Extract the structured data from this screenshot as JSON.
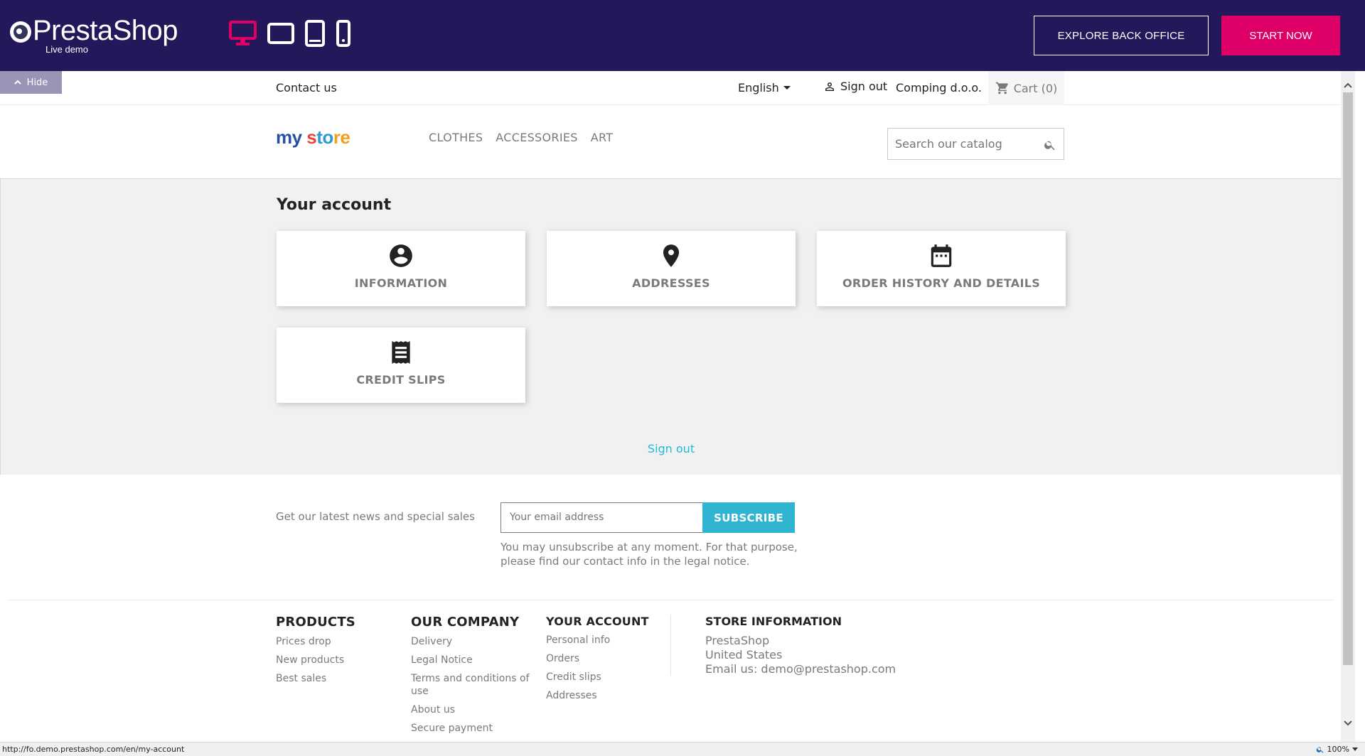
{
  "demo_bar": {
    "brand": "PrestaShop",
    "brand_sub": "Live demo",
    "explore_label": "EXPLORE BACK OFFICE",
    "start_label": "START NOW",
    "hide_label": "Hide",
    "active_device_color": "#df0067",
    "bar_color": "#25185a"
  },
  "nav": {
    "contact": "Contact us",
    "language": "English",
    "signout": "Sign out",
    "customer": "Comping d.o.o.",
    "cart": "Cart (0)"
  },
  "header": {
    "logo": {
      "p1": "my",
      "p2": " s",
      "p3": "to",
      "p4": "re"
    },
    "menu": [
      "CLOTHES",
      "ACCESSORIES",
      "ART"
    ],
    "search_placeholder": "Search our catalog"
  },
  "account": {
    "title": "Your account",
    "tiles": [
      {
        "label": "INFORMATION",
        "icon": "account-circle-icon"
      },
      {
        "label": "ADDRESSES",
        "icon": "location-pin-icon"
      },
      {
        "label": "ORDER HISTORY AND DETAILS",
        "icon": "calendar-icon"
      },
      {
        "label": "CREDIT SLIPS",
        "icon": "receipt-icon"
      }
    ],
    "signout": "Sign out",
    "link_color": "#24b9d7"
  },
  "newsletter": {
    "label": "Get our latest news and special sales",
    "email_placeholder": "Your email address",
    "subscribe": "SUBSCRIBE",
    "note": "You may unsubscribe at any moment. For that purpose, please find our contact info in the legal notice."
  },
  "footer": {
    "products": {
      "title": "PRODUCTS",
      "links": [
        "Prices drop",
        "New products",
        "Best sales"
      ]
    },
    "company": {
      "title": "OUR COMPANY",
      "links": [
        "Delivery",
        "Legal Notice",
        "Terms and conditions of use",
        "About us",
        "Secure payment"
      ]
    },
    "your_account": {
      "title": "YOUR ACCOUNT",
      "links": [
        "Personal info",
        "Orders",
        "Credit slips",
        "Addresses"
      ]
    },
    "store": {
      "title": "STORE INFORMATION",
      "lines": [
        "PrestaShop",
        "United States",
        "Email us: demo@prestashop.com"
      ]
    }
  },
  "status": {
    "url": "http://fo.demo.prestashop.com/en/my-account",
    "zoom": "100%"
  }
}
